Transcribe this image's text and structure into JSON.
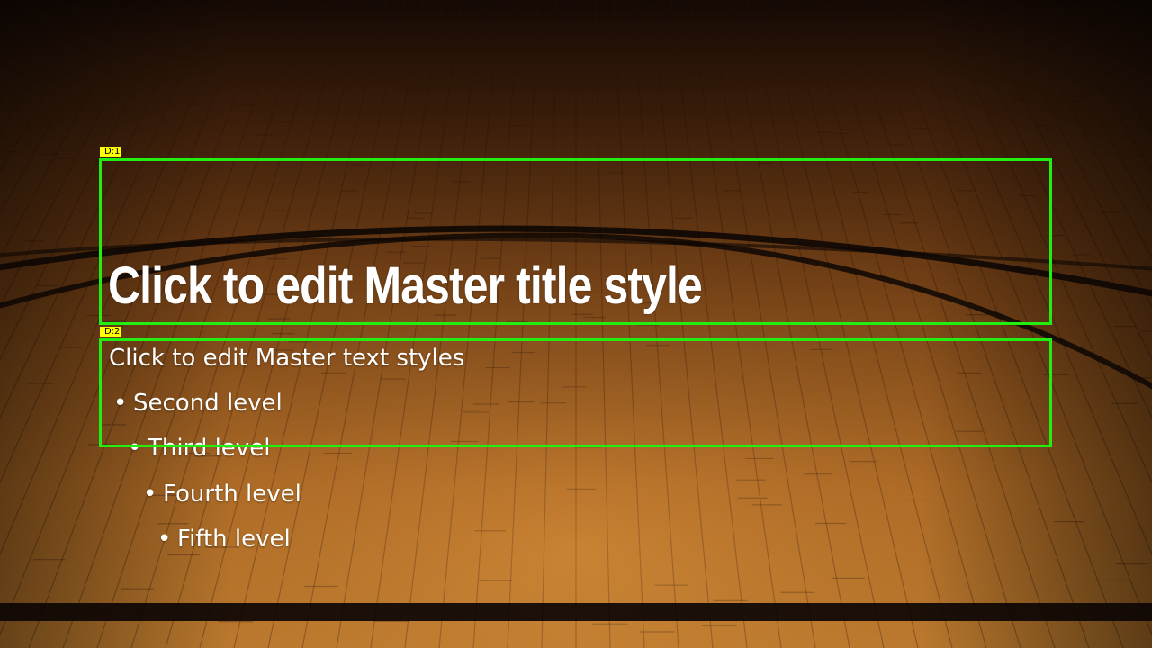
{
  "slide": {
    "title": "Click to edit Master title style",
    "body_levels": [
      "Click to edit Master text styles",
      "Second level",
      "Third level",
      "Fourth level",
      "Fifth level"
    ],
    "bullet_glyph": "•",
    "text_color": "#ffffff"
  },
  "annotations": {
    "box_color": "#22ee11",
    "tag_color": "#ffff00",
    "title_tag": "ID:1",
    "body_tag": "ID:2"
  },
  "background": {
    "description_icon": "hardwood-court-floor",
    "wood_light": "#c8812f",
    "wood_dark": "#3a1d0a",
    "line_color": "#0d0704"
  }
}
